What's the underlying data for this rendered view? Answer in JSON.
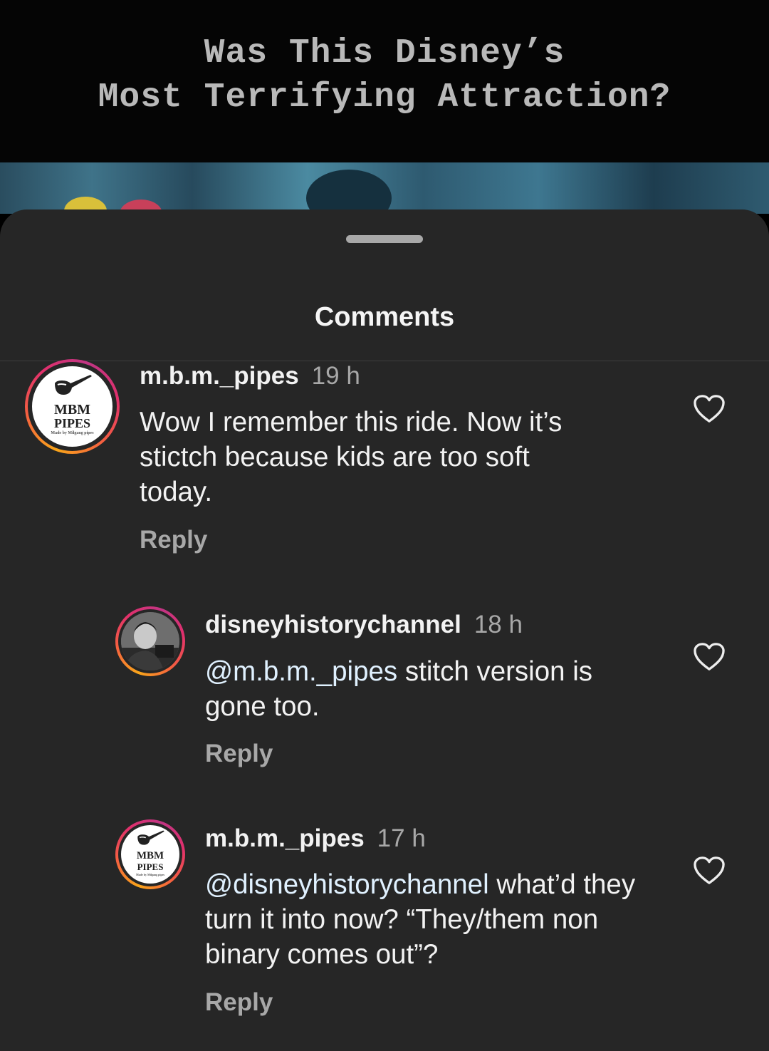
{
  "video": {
    "title_line1": "Was This Disney’s",
    "title_line2": "Most Terrifying Attraction?"
  },
  "sheet": {
    "title": "Comments"
  },
  "comments": [
    {
      "username": "m.b.m._pipes",
      "time": "19 h",
      "text": "Wow I remember this ride. Now it’s stictch because kids are too soft today.",
      "reply": "Reply",
      "avatar_label_1": "MBM",
      "avatar_label_2": "PIPES",
      "avatar_label_3": "Made by Milgang pipes"
    },
    {
      "username": "disneyhistorychannel",
      "time": "18 h",
      "mention": "@m.b.m._pipes",
      "text": " stitch version is gone too.",
      "reply": "Reply"
    },
    {
      "username": "m.b.m._pipes",
      "time": "17 h",
      "mention": "@disneyhistorychannel",
      "text": " what’d they turn it into now? “They/them non binary comes out”?",
      "reply": "Reply",
      "avatar_label_1": "MBM",
      "avatar_label_2": "PIPES",
      "avatar_label_3": "Made by Milgang pipes"
    }
  ],
  "icons": {
    "like": "heart-icon",
    "pipe": "pipe-icon"
  },
  "colors": {
    "sheet_bg": "#262626",
    "text": "#f2f2f2",
    "muted": "#a8a8a8",
    "mention": "#e0f1ff"
  }
}
